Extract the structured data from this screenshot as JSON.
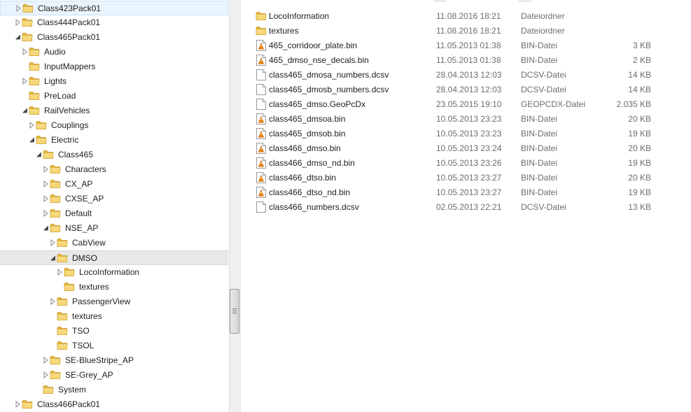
{
  "tree": [
    {
      "label": "Class423Pack01",
      "depth": 0,
      "twisty": "collapsed",
      "state": "hover"
    },
    {
      "label": "Class444Pack01",
      "depth": 0,
      "twisty": "collapsed"
    },
    {
      "label": "Class465Pack01",
      "depth": 0,
      "twisty": "expanded"
    },
    {
      "label": "Audio",
      "depth": 1,
      "twisty": "collapsed"
    },
    {
      "label": "InputMappers",
      "depth": 1,
      "twisty": "none"
    },
    {
      "label": "Lights",
      "depth": 1,
      "twisty": "collapsed"
    },
    {
      "label": "PreLoad",
      "depth": 1,
      "twisty": "none"
    },
    {
      "label": "RailVehicles",
      "depth": 1,
      "twisty": "expanded"
    },
    {
      "label": "Couplings",
      "depth": 2,
      "twisty": "collapsed"
    },
    {
      "label": "Electric",
      "depth": 2,
      "twisty": "expanded"
    },
    {
      "label": "Class465",
      "depth": 3,
      "twisty": "expanded"
    },
    {
      "label": "Characters",
      "depth": 4,
      "twisty": "collapsed"
    },
    {
      "label": "CX_AP",
      "depth": 4,
      "twisty": "collapsed"
    },
    {
      "label": "CXSE_AP",
      "depth": 4,
      "twisty": "collapsed"
    },
    {
      "label": "Default",
      "depth": 4,
      "twisty": "collapsed"
    },
    {
      "label": "NSE_AP",
      "depth": 4,
      "twisty": "expanded"
    },
    {
      "label": "CabView",
      "depth": 5,
      "twisty": "collapsed"
    },
    {
      "label": "DMSO",
      "depth": 5,
      "twisty": "expanded",
      "state": "selected"
    },
    {
      "label": "LocoInformation",
      "depth": 6,
      "twisty": "collapsed"
    },
    {
      "label": "textures",
      "depth": 6,
      "twisty": "none"
    },
    {
      "label": "PassengerView",
      "depth": 5,
      "twisty": "collapsed"
    },
    {
      "label": "textures",
      "depth": 5,
      "twisty": "none"
    },
    {
      "label": "TSO",
      "depth": 5,
      "twisty": "none"
    },
    {
      "label": "TSOL",
      "depth": 5,
      "twisty": "none"
    },
    {
      "label": "SE-BlueStripe_AP",
      "depth": 4,
      "twisty": "collapsed"
    },
    {
      "label": "SE-Grey_AP",
      "depth": 4,
      "twisty": "collapsed"
    },
    {
      "label": "System",
      "depth": 3,
      "twisty": "none"
    },
    {
      "label": "Class466Pack01",
      "depth": 0,
      "twisty": "collapsed"
    }
  ],
  "files": [
    {
      "name": "LocoInformation",
      "date": "11.08.2016 18:21",
      "type": "Dateiordner",
      "size": "",
      "icon": "folder-icon"
    },
    {
      "name": "textures",
      "date": "11.08.2016 18:21",
      "type": "Dateiordner",
      "size": "",
      "icon": "folder-icon"
    },
    {
      "name": "465_corridoor_plate.bin",
      "date": "11.05.2013 01:38",
      "type": "BIN-Datei",
      "size": "3 KB",
      "icon": "vlc-file-icon"
    },
    {
      "name": "465_dmso_nse_decals.bin",
      "date": "11.05.2013 01:38",
      "type": "BIN-Datei",
      "size": "2 KB",
      "icon": "vlc-file-icon"
    },
    {
      "name": "class465_dmosa_numbers.dcsv",
      "date": "28.04.2013 12:03",
      "type": "DCSV-Datei",
      "size": "14 KB",
      "icon": "blank-file-icon"
    },
    {
      "name": "class465_dmosb_numbers.dcsv",
      "date": "28.04.2013 12:03",
      "type": "DCSV-Datei",
      "size": "14 KB",
      "icon": "blank-file-icon"
    },
    {
      "name": "class465_dmso.GeoPcDx",
      "date": "23.05.2015 19:10",
      "type": "GEOPCDX-Datei",
      "size": "2.035 KB",
      "icon": "blank-file-icon"
    },
    {
      "name": "class465_dmsoa.bin",
      "date": "10.05.2013 23:23",
      "type": "BIN-Datei",
      "size": "20 KB",
      "icon": "vlc-file-icon"
    },
    {
      "name": "class465_dmsob.bin",
      "date": "10.05.2013 23:23",
      "type": "BIN-Datei",
      "size": "19 KB",
      "icon": "vlc-file-icon"
    },
    {
      "name": "class466_dmso.bin",
      "date": "10.05.2013 23:24",
      "type": "BIN-Datei",
      "size": "20 KB",
      "icon": "vlc-file-icon"
    },
    {
      "name": "class466_dmso_nd.bin",
      "date": "10.05.2013 23:26",
      "type": "BIN-Datei",
      "size": "19 KB",
      "icon": "vlc-file-icon"
    },
    {
      "name": "class466_dtso.bin",
      "date": "10.05.2013 23:27",
      "type": "BIN-Datei",
      "size": "20 KB",
      "icon": "vlc-file-icon"
    },
    {
      "name": "class466_dtso_nd.bin",
      "date": "10.05.2013 23:27",
      "type": "BIN-Datei",
      "size": "19 KB",
      "icon": "vlc-file-icon"
    },
    {
      "name": "class466_numbers.dcsv",
      "date": "02.05.2013 22:21",
      "type": "DCSV-Datei",
      "size": "13 KB",
      "icon": "blank-file-icon"
    }
  ],
  "colors": {
    "folder": "#f2c94c",
    "hover_bg": "#eaf4fd",
    "selected_bg": "#e8e8e8",
    "vlc_orange": "#f08a12"
  }
}
